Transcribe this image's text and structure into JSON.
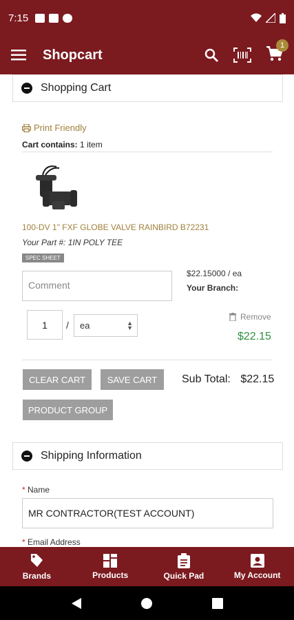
{
  "status_bar": {
    "time": "7:15"
  },
  "app_bar": {
    "title": "Shopcart",
    "cart_badge": "1"
  },
  "cart_section": {
    "header": "Shopping Cart",
    "print_friendly": "Print Friendly",
    "cart_contains_label": "Cart contains:",
    "cart_contains_value": "1 item"
  },
  "item": {
    "title": "100-DV 1\" FXF GLOBE VALVE RAINBIRD B72231",
    "your_part": "Your Part #: 1IN POLY TEE",
    "spec_sheet": "SPEC SHEET",
    "comment_placeholder": "Comment",
    "unit_price": "$22.15000 / ea",
    "branch_label": "Your Branch:",
    "quantity": "1",
    "separator": "/",
    "uom": "ea",
    "remove_label": "Remove",
    "line_total": "$22.15"
  },
  "actions": {
    "clear_cart": "CLEAR CART",
    "save_cart": "SAVE CART",
    "product_group": "PRODUCT GROUP",
    "subtotal_label": "Sub Total:",
    "subtotal_value": "$22.15"
  },
  "shipping_section": {
    "header": "Shipping Information",
    "name_label": "Name",
    "name_value": "MR CONTRACTOR(TEST ACCOUNT)",
    "email_label": "Email Address",
    "required_mark": "*"
  },
  "bottom_nav": [
    {
      "label": "Brands",
      "icon": "tag-icon"
    },
    {
      "label": "Products",
      "icon": "grid-icon"
    },
    {
      "label": "Quick Pad",
      "icon": "clipboard-icon"
    },
    {
      "label": "My Account",
      "icon": "account-box-icon"
    }
  ],
  "colors": {
    "brand": "#7b1a1f",
    "accent": "#a0803a",
    "price": "#2f8f3f",
    "button": "#9e9e9e"
  }
}
